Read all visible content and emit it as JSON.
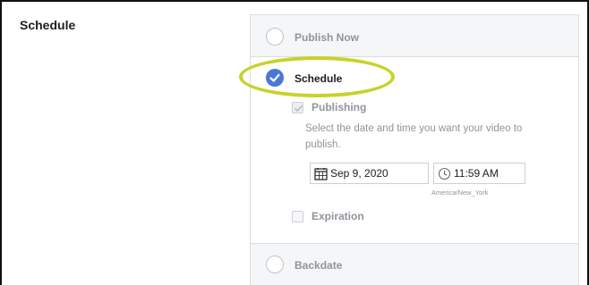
{
  "section": {
    "label": "Schedule"
  },
  "options": {
    "publish_now": {
      "label": "Publish Now",
      "selected": false
    },
    "schedule": {
      "label": "Schedule",
      "selected": true
    },
    "backdate": {
      "label": "Backdate",
      "selected": false
    }
  },
  "publishing": {
    "label": "Publishing",
    "checked": true,
    "help_text": "Select the date and time you want your video to publish.",
    "date": "Sep 9, 2020",
    "time": "11:59 AM",
    "timezone": "America/New_York"
  },
  "expiration": {
    "label": "Expiration",
    "checked": false
  },
  "colors": {
    "accent": "#4a76d8",
    "highlight": "#c7d22a",
    "muted": "#90949c"
  },
  "icons": {
    "schedule_radio": "checkmark-circle-icon",
    "date_field": "calendar-icon",
    "time_field": "clock-icon"
  }
}
